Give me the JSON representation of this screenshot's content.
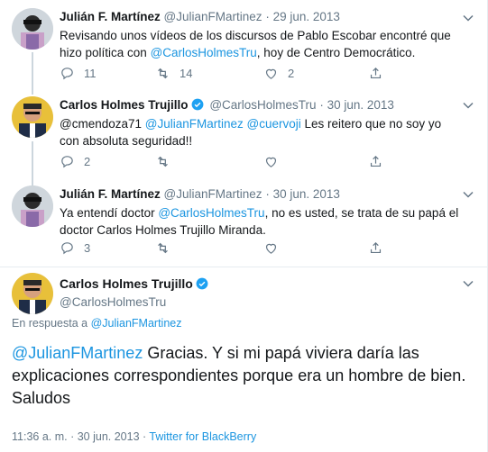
{
  "tweets": [
    {
      "name": "Julián F. Martínez",
      "handle": "@JulianFMartinez",
      "sep": "·",
      "date": "29 jun. 2013",
      "text_1": "Revisando unos vídeos de los discursos de Pablo Escobar encontré que hizo política con ",
      "mention_1": "@CarlosHolmesTru",
      "text_2": ", hoy de Centro Democrático.",
      "replies": "11",
      "retweets": "14",
      "likes": "2"
    },
    {
      "name": "Carlos Holmes Trujillo",
      "handle": "@CarlosHolmesTru",
      "sep": "·",
      "date": "30 jun. 2013",
      "text_1": "@cmendoza71 ",
      "mention_1": "@JulianFMartinez",
      "mention_2": "@cuervoji",
      "text_2": " Les reitero que no soy yo con absoluta seguridad!!",
      "replies": "2",
      "retweets": "",
      "likes": ""
    },
    {
      "name": "Julián F. Martínez",
      "handle": "@JulianFMartinez",
      "sep": "·",
      "date": "30 jun. 2013",
      "text_1": "Ya entendí doctor ",
      "mention_1": "@CarlosHolmesTru",
      "text_2": ", no es usted, se trata de su papá el doctor Carlos Holmes Trujillo Miranda.",
      "replies": "3",
      "retweets": "",
      "likes": ""
    }
  ],
  "main": {
    "name": "Carlos Holmes Trujillo",
    "handle": "@CarlosHolmesTru",
    "replying_prefix": "En respuesta a ",
    "replying_to": "@JulianFMartinez",
    "mention": "@JulianFMartinez",
    "text": " Gracias. Y si mi papá viviera daría las explicaciones correspondientes porque era un hombre de bien. Saludos",
    "time": "11:36 a. m. · 30 jun. 2013 · ",
    "source": "Twitter for BlackBerry"
  },
  "colors": {
    "link": "#1b95e0",
    "muted": "#657786",
    "verified": "#1da1f2"
  },
  "icons": [
    "chevron-down-icon",
    "reply-icon",
    "retweet-icon",
    "like-icon",
    "share-icon",
    "verified-badge-icon"
  ]
}
